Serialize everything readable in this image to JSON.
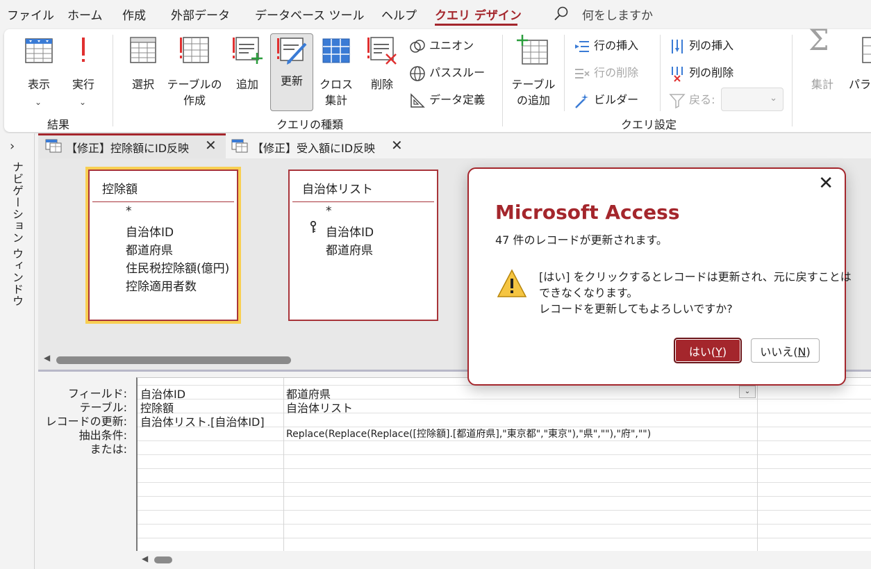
{
  "menu": {
    "items": [
      "ファイル",
      "ホーム",
      "作成",
      "外部データ",
      "データベース ツール",
      "ヘルプ",
      "クエリ デザイン"
    ],
    "active_index": 6,
    "search_text": "何をしますか"
  },
  "ribbon": {
    "results": {
      "view": "表示",
      "run": "実行",
      "group_label": "結果"
    },
    "query_type": {
      "select": "選択",
      "make_table_1": "テーブルの",
      "make_table_2": "作成",
      "append": "追加",
      "update": "更新",
      "crosstab_1": "クロス",
      "crosstab_2": "集計",
      "delete": "削除",
      "union": "ユニオン",
      "passthrough": "パススルー",
      "data_definition": "データ定義",
      "group_label": "クエリの種類"
    },
    "query_setup": {
      "add_table_1": "テーブル",
      "add_table_2": "の追加",
      "insert_rows": "行の挿入",
      "delete_rows": "行の削除",
      "builder": "ビルダー",
      "insert_columns": "列の挿入",
      "delete_columns": "列の削除",
      "return_label": "戻る:",
      "group_label": "クエリ設定"
    },
    "show_hide": {
      "totals": "集計",
      "parameters": "パラメ"
    }
  },
  "nav_pane": {
    "label": "ナビゲーション ウィンドウ"
  },
  "tabs": [
    {
      "label": "【修正】控除額にID反映",
      "active": true
    },
    {
      "label": "【修正】受入額にID反映",
      "active": false
    }
  ],
  "tables": [
    {
      "name": "控除額",
      "fields": [
        "*",
        "自治体ID",
        "都道府県",
        "住民税控除額(億円)",
        "控除適用者数"
      ]
    },
    {
      "name": "自治体リスト",
      "fields": [
        "*",
        "自治体ID",
        "都道府県"
      ]
    }
  ],
  "grid": {
    "row_labels": [
      "フィールド:",
      "テーブル:",
      "レコードの更新:",
      "抽出条件:",
      "または:"
    ],
    "columns": [
      {
        "field": "自治体ID",
        "table": "控除額",
        "update_to": "自治体リスト.[自治体ID]",
        "criteria": ""
      },
      {
        "field": "都道府県",
        "table": "自治体リスト",
        "update_to": "",
        "criteria": "Replace(Replace(Replace([控除額].[都道府県],\"東京都\",\"東京\"),\"県\",\"\"),\"府\",\"\")"
      }
    ]
  },
  "dialog": {
    "title": "Microsoft Access",
    "subtitle": "47 件のレコードが更新されます。",
    "message_lines": [
      "[はい] をクリックするとレコードは更新され、元に戻すことは",
      "できなくなります。",
      "レコードを更新してもよろしいですか?"
    ],
    "yes_text": "はい(",
    "yes_key": "Y",
    "yes_close": ")",
    "no_text": "いいえ(",
    "no_key": "N",
    "no_close": ")"
  },
  "colors": {
    "accent": "#a4262c",
    "table_highlight": "#f8cf52"
  }
}
